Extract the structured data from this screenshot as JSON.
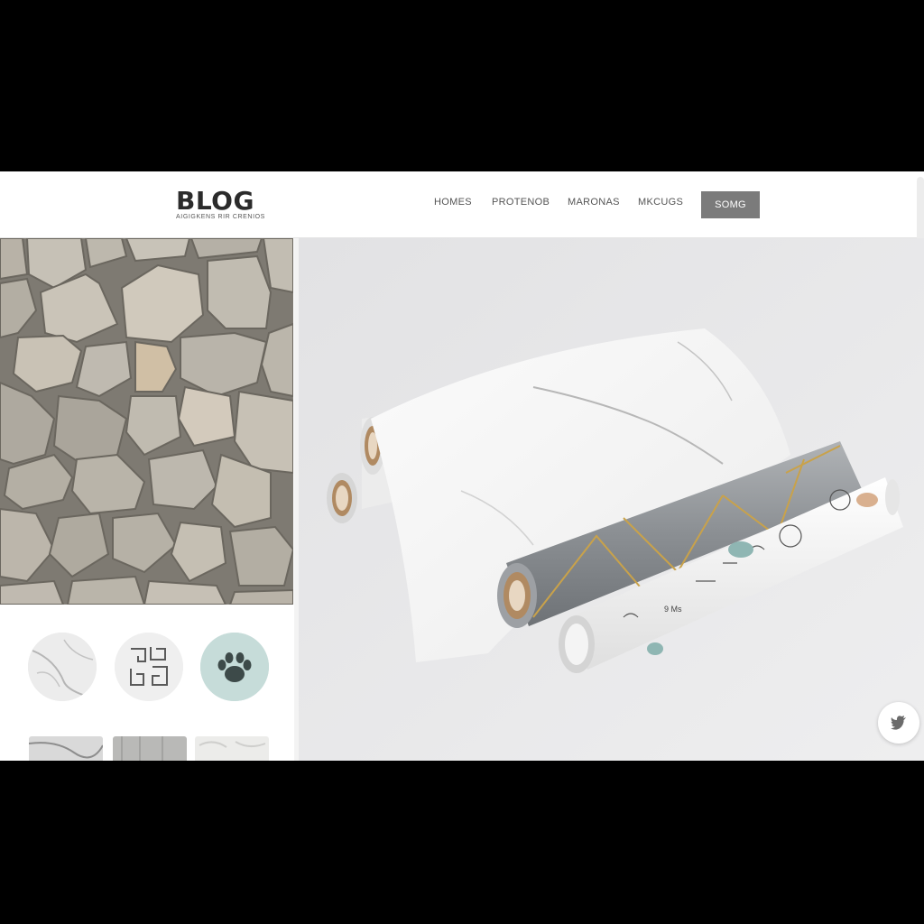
{
  "header": {
    "logo_title": "BLOG",
    "logo_tagline": "AIGIGKENS RIR CRENIOS",
    "nav": [
      "HOMES",
      "PROTENOB",
      "MARONAS",
      "MKCUGS"
    ],
    "cta_label": "SOMG"
  },
  "hero": {
    "roll_label": "9 Ms"
  },
  "sidebar": {
    "round_swatches": [
      "marble-swatch-icon",
      "geometric-maze-swatch-icon",
      "paw-print-swatch-icon"
    ],
    "thumbnails": [
      "marble-thumbnail",
      "wood-grain-thumbnail",
      "white-stone-thumbnail"
    ]
  },
  "colors": {
    "cta_background": "#7b7b7b",
    "paw_swatch": "#c6dcd9",
    "page_background": "#ffffff",
    "letterbox": "#000000"
  }
}
